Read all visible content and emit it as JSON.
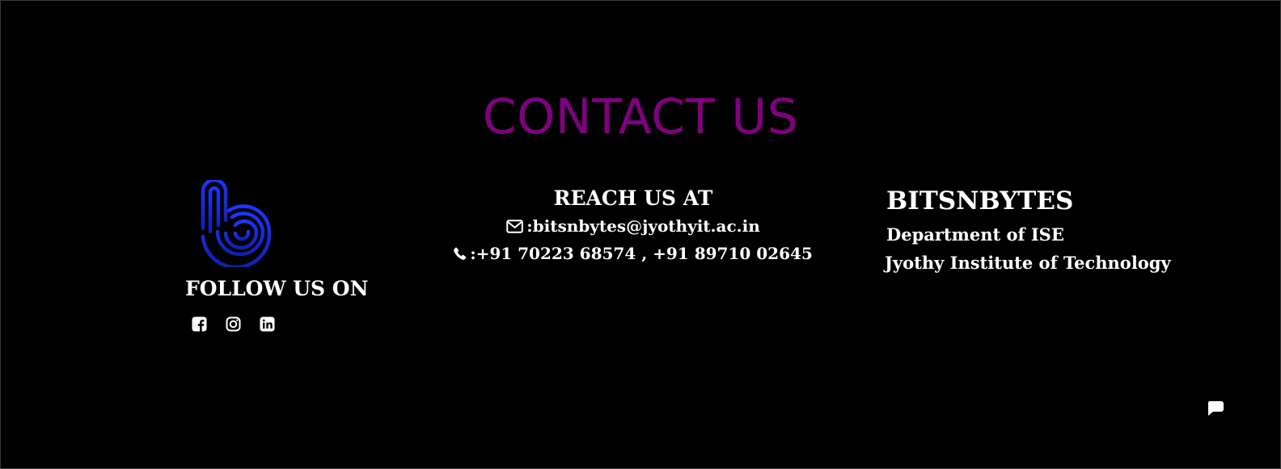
{
  "contact": {
    "title": "CONTACT US"
  },
  "follow": {
    "heading": "FOLLOW US ON",
    "links": [
      {
        "icon": "facebook-icon"
      },
      {
        "icon": "instagram-icon"
      },
      {
        "icon": "linkedin-icon"
      }
    ]
  },
  "reach": {
    "heading": "REACH US AT",
    "email_icon": "envelope-icon",
    "email": ":bitsnbytes@jyothyit.ac.in",
    "phone_icon": "phone-icon",
    "phone": ":+91 70223 68574 , +91 89710 02645"
  },
  "brand": {
    "name": "BITSNBYTES",
    "department": "Department of ISE",
    "institute": "Jyothy Institute of Technology"
  },
  "chat": {
    "icon": "chat-icon"
  },
  "colors": {
    "background": "#000000",
    "title": "#800080",
    "logo_blue": "#1a2ee0",
    "text": "#ffffff"
  }
}
